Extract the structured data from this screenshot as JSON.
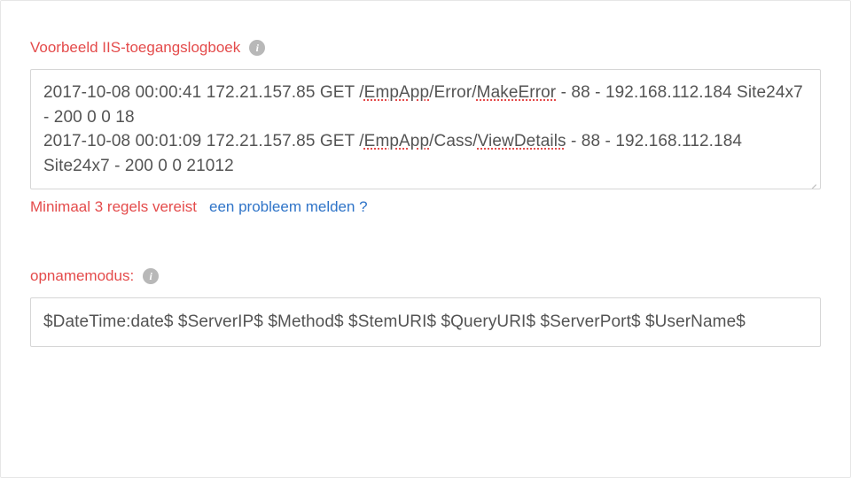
{
  "labels": {
    "sample_log_title": "Voorbeeld IIS-toegangslogboek",
    "helper_min_lines": "Minimaal 3 regels vereist",
    "helper_report": "een probleem melden ?",
    "mode_title": "opnamemodus:"
  },
  "log_sample": {
    "lines": [
      {
        "prefix": "2017-10-08 00:00:41 172.21.157.85 GET /",
        "spell1": "EmpApp",
        "mid1": "/Error/",
        "spell2": "MakeError",
        "suffix": " - 88 - 192.168.112.184 Site24x7 - 200 0 0 18"
      },
      {
        "prefix": "2017-10-08 00:01:09 172.21.157.85 GET /",
        "spell1": "EmpApp",
        "mid1": "/Cass/",
        "spell2": "ViewDetails",
        "suffix": " - 88 - 192.168.112.184 Site24x7 - 200 0 0 21012"
      }
    ]
  },
  "pattern": {
    "value": "$DateTime:date$ $ServerIP$ $Method$ $StemURI$ $QueryURI$ $ServerPort$ $UserName$"
  }
}
